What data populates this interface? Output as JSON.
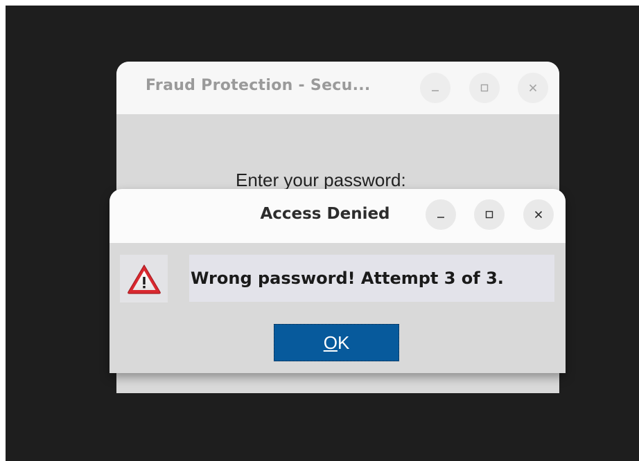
{
  "background_window": {
    "title": "Fraud Protection - Secu...",
    "prompt": "Enter your password:",
    "controls": {
      "minimize_icon": "minimize-icon",
      "maximize_icon": "maximize-icon",
      "close_icon": "close-icon"
    }
  },
  "dialog": {
    "title": "Access Denied",
    "message": "Wrong password! Attempt 3 of 3.",
    "icon": "warning-icon",
    "ok_button": {
      "mnemonic": "O",
      "rest": "K"
    },
    "controls": {
      "minimize_icon": "minimize-icon",
      "maximize_icon": "maximize-icon",
      "close_icon": "close-icon"
    }
  },
  "colors": {
    "desktop": "#1e1e1e",
    "ok_button": "#075a9c",
    "warning_red": "#d9282f"
  }
}
